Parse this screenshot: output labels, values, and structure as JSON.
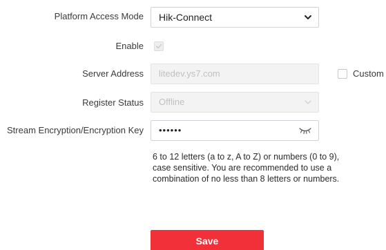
{
  "form": {
    "platform_access_mode": {
      "label": "Platform Access Mode",
      "selected": "Hik-Connect"
    },
    "enable": {
      "label": "Enable",
      "checked": true,
      "disabled": true
    },
    "server_address": {
      "label": "Server Address",
      "value": "litedev.ys7.com",
      "custom_label": "Custom",
      "custom_checked": false
    },
    "register_status": {
      "label": "Register Status",
      "selected": "Offline"
    },
    "stream_encryption_key": {
      "label": "Stream Encryption/Encryption Key",
      "value": "••••••",
      "icon": "eye-closed-icon"
    },
    "hint": "6 to 12 letters (a to z, A to Z) or numbers (0 to 9), case sensitive. You are recommended to use a combination of no less than 8 letters or numbers."
  },
  "actions": {
    "save_label": "Save"
  },
  "colors": {
    "accent": "#f2303a",
    "label_text": "#3a3a3a",
    "disabled_text": "#c0c0c0"
  }
}
